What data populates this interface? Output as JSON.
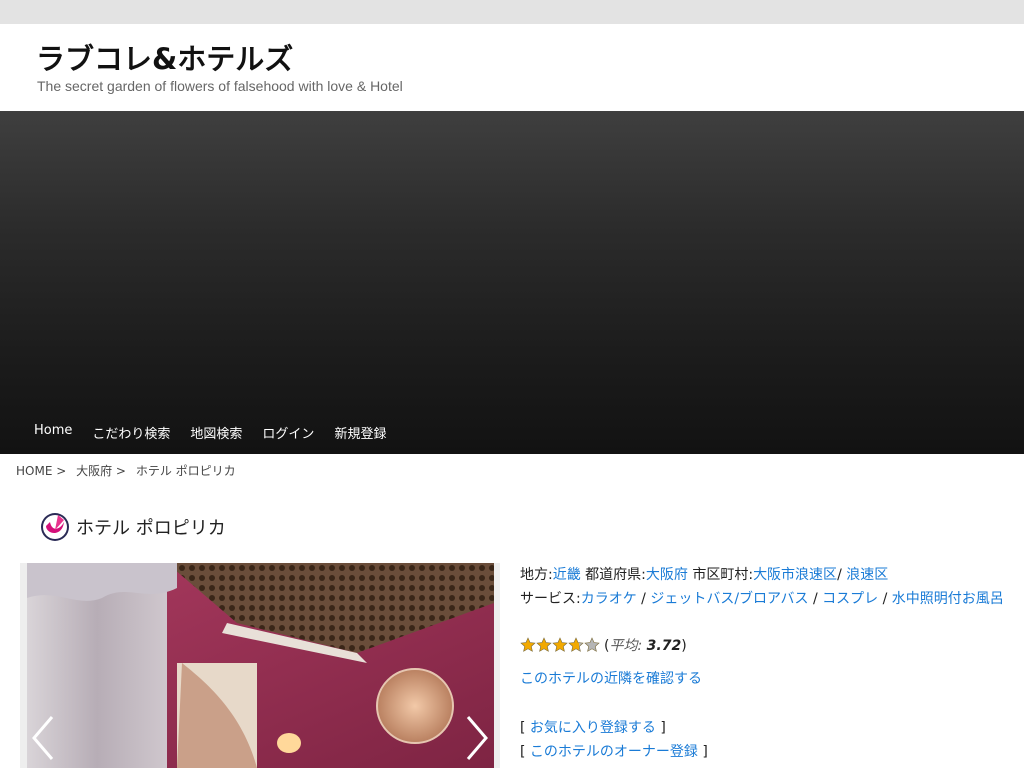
{
  "site": {
    "title": "ラブコレ&ホテルズ",
    "tagline": "The secret garden of flowers of falsehood with love & Hotel"
  },
  "nav": {
    "items": [
      "Home",
      "こだわり検索",
      "地図検索",
      "ログイン",
      "新規登録"
    ]
  },
  "breadcrumb": {
    "items": [
      "HOME >",
      "大阪府 >",
      "ホテル ポロピリカ"
    ]
  },
  "hotel": {
    "name": "ホテル ポロピリカ",
    "logo_icon": "magenta-swirl-logo-icon"
  },
  "info": {
    "region_label": "地方:",
    "region_value": "近畿",
    "pref_label": "都道府県:",
    "pref_value": "大阪府",
    "city_label": "市区町村:",
    "city_value_1": "大阪市浪速区",
    "city_sep": "/",
    "city_value_2": "浪速区",
    "service_label": "サービス:",
    "services": [
      "カラオケ",
      "ジェットバス/ブロアバス",
      "コスプレ",
      "水中照明付お風呂"
    ],
    "service_sep": "/"
  },
  "rating": {
    "stars_filled": 3.72,
    "stars_total": 5,
    "avg_prefix": "(",
    "avg_label": "平均:",
    "avg_value": "3.72",
    "avg_suffix": ")"
  },
  "actions": {
    "nearby_link": "このホテルの近隣を確認する",
    "bracket_open": "[",
    "bracket_close": "]",
    "favorite_link": "お気に入り登録する",
    "owner_link": "このホテルのオーナー登録"
  },
  "colors": {
    "link": "#1a7bd6",
    "star_gold": "#f2a900",
    "hero_dark": "#121212"
  }
}
